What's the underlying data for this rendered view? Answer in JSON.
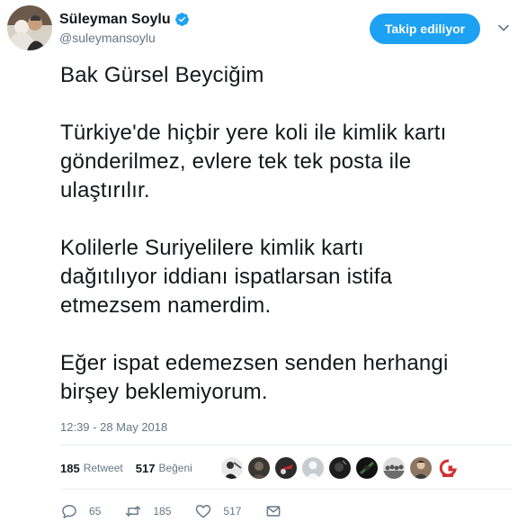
{
  "author": {
    "display_name": "Süleyman Soylu",
    "handle": "@suleymansoylu",
    "verified_icon": "verified-badge-icon",
    "verified_color": "#1da1f2"
  },
  "follow_button": {
    "label": "Takip ediliyor",
    "color": "#1da1f2"
  },
  "menu_icon": "chevron-down-icon",
  "tweet": {
    "paragraphs": [
      {
        "lines": [
          "Bak Gürsel Beyciğim"
        ]
      },
      {
        "lines": [
          "Türkiye'de hiçbir yere koli ile kimlik kartı",
          "gönderilmez, evlere tek tek posta ile",
          "ulaştırılır."
        ]
      },
      {
        "lines": [
          "Kolilerle Suriyelilere kimlik kartı",
          "dağıtılıyor iddianı ispatlarsan istifa",
          "etmezsem namerdim."
        ]
      },
      {
        "lines": [
          "Eğer ispat edemezsen senden herhangi",
          "birşey beklemiyorum."
        ]
      }
    ]
  },
  "timestamp": "12:39 - 28 May 2018",
  "stats": {
    "retweets": {
      "count": "185",
      "label": "Retweet"
    },
    "likes": {
      "count": "517",
      "label": "Beğeni"
    }
  },
  "likers": [
    "liker-avatar-1",
    "liker-avatar-2",
    "liker-avatar-3",
    "liker-avatar-4",
    "liker-avatar-5",
    "liker-avatar-6",
    "liker-avatar-7",
    "liker-avatar-8",
    "liker-avatar-9"
  ],
  "actions": {
    "reply": {
      "icon": "reply-icon",
      "count": "65"
    },
    "retweet": {
      "icon": "retweet-icon",
      "count": "185"
    },
    "like": {
      "icon": "heart-icon",
      "count": "517"
    },
    "message": {
      "icon": "envelope-icon"
    }
  }
}
